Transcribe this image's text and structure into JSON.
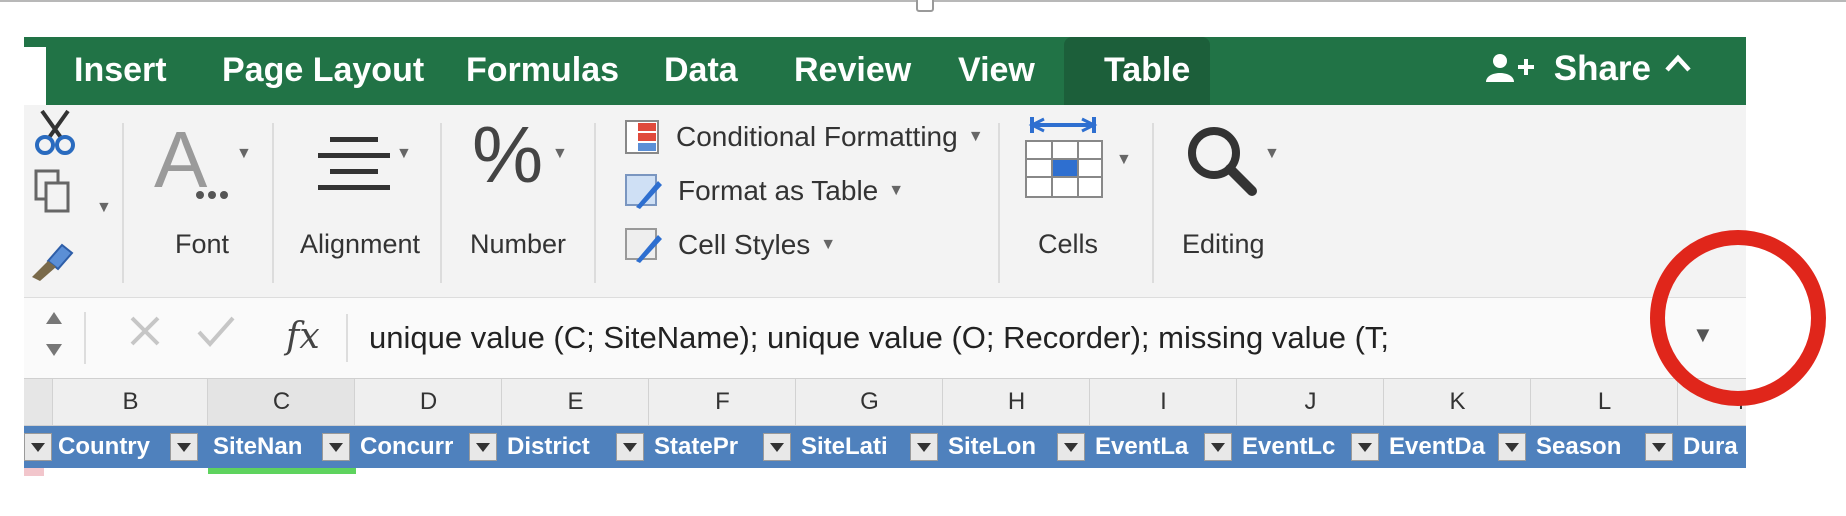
{
  "ribbon_tabs": [
    "Insert",
    "Page Layout",
    "Formulas",
    "Data",
    "Review",
    "View",
    "Table"
  ],
  "share_label": "Share",
  "groups": {
    "font_label": "Font",
    "alignment_label": "Alignment",
    "number_label": "Number",
    "cells_label": "Cells",
    "editing_label": "Editing"
  },
  "styles": {
    "conditional_formatting": "Conditional Formatting",
    "format_as_table": "Format as Table",
    "cell_styles": "Cell Styles"
  },
  "formula_bar": {
    "fx_label": "fx",
    "content": "unique value (C; SiteName); unique value (O; Recorder); missing value (T;"
  },
  "column_letters": [
    "B",
    "C",
    "D",
    "E",
    "F",
    "G",
    "H",
    "I",
    "J",
    "K",
    "L",
    "M"
  ],
  "table_headers": [
    "Country",
    "SiteNan",
    "Concurr",
    "District",
    "StatePr",
    "SiteLati",
    "SiteLon",
    "EventLa",
    "EventLc",
    "EventDa",
    "Season",
    "Dura"
  ],
  "colors": {
    "ribbon_green": "#217346",
    "active_tab": "#1c5f3a",
    "table_header_blue": "#4f81bd",
    "annotation_red": "#e0261b",
    "selection_green": "#5ed35e"
  },
  "icons": [
    "cut-icon",
    "copy-icon",
    "format-painter-icon",
    "font-icon",
    "align-icon",
    "percent-icon",
    "conditional-formatting-icon",
    "format-table-icon",
    "cell-styles-icon",
    "cells-icon",
    "search-icon",
    "share-person-icon",
    "collapse-ribbon-icon",
    "cancel-icon",
    "enter-icon",
    "formula-expand-icon"
  ]
}
